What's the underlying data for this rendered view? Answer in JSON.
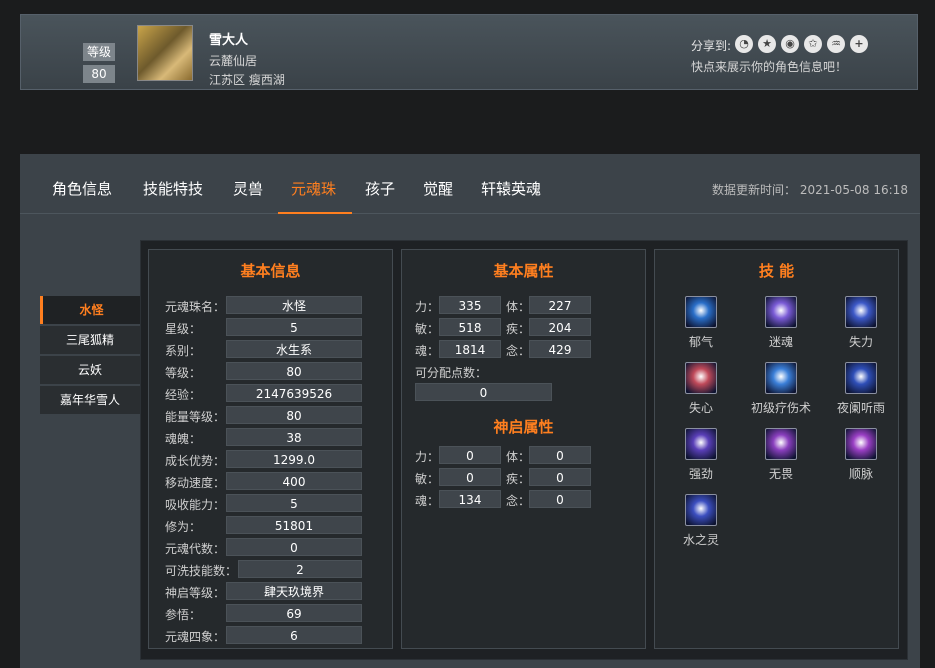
{
  "profile": {
    "level_label": "等级",
    "level_value": "80",
    "name": "雪大人",
    "server": "云麓仙居",
    "region": "江苏区 瘦西湖",
    "share_label": "分享到:",
    "share_icons": [
      "wechat-icon",
      "qzone-icon",
      "weibo-icon",
      "star-icon",
      "tencent-weibo-icon",
      "plus-icon"
    ],
    "share_hint": "快点来展示你的角色信息吧！"
  },
  "tabs": [
    "角色信息",
    "技能特技",
    "灵兽",
    "元魂珠",
    "孩子",
    "觉醒",
    "轩辕英魂"
  ],
  "active_tab": "元魂珠",
  "update_time": "数据更新时间： 2021-05-08 16:18",
  "side_list": [
    "水怪",
    "三尾狐精",
    "云妖",
    "嘉年华雪人"
  ],
  "basic_info": {
    "title": "基本信息",
    "rows": [
      {
        "label": "元魂珠名：",
        "value": "水怪"
      },
      {
        "label": "星级：",
        "value": "5"
      },
      {
        "label": "系别：",
        "value": "水生系"
      },
      {
        "label": "等级：",
        "value": "80"
      },
      {
        "label": "经验：",
        "value": "2147639526"
      },
      {
        "label": "能量等级：",
        "value": "80"
      },
      {
        "label": "魂魄：",
        "value": "38"
      },
      {
        "label": "成长优势：",
        "value": "1299.0"
      },
      {
        "label": "移动速度：",
        "value": "400"
      },
      {
        "label": "吸收能力：",
        "value": "5"
      },
      {
        "label": "修为：",
        "value": "51801"
      },
      {
        "label": "元魂代数：",
        "value": "0"
      },
      {
        "label": "可洗技能数：",
        "value": "2"
      },
      {
        "label": "神启等级：",
        "value": "肆天玖境界"
      },
      {
        "label": "参悟：",
        "value": "69"
      },
      {
        "label": "元魂四象：",
        "value": "6"
      }
    ]
  },
  "basic_attr": {
    "title": "基本属性",
    "pairs": [
      {
        "l1": "力：",
        "v1": "335",
        "l2": "体：",
        "v2": "227"
      },
      {
        "l1": "敏：",
        "v1": "518",
        "l2": "疾：",
        "v2": "204"
      },
      {
        "l1": "魂：",
        "v1": "1814",
        "l2": "念：",
        "v2": "429"
      }
    ],
    "free_points_label": "可分配点数：",
    "free_points": "0"
  },
  "divine_attr": {
    "title": "神启属性",
    "pairs": [
      {
        "l1": "力：",
        "v1": "0",
        "l2": "体：",
        "v2": "0"
      },
      {
        "l1": "敏：",
        "v1": "0",
        "l2": "疾：",
        "v2": "0"
      },
      {
        "l1": "魂：",
        "v1": "134",
        "l2": "念：",
        "v2": "0"
      }
    ]
  },
  "skills": {
    "title": "技 能",
    "items": [
      {
        "name": "郁气",
        "color": "#2a6fc9"
      },
      {
        "name": "迷魂",
        "color": "#7a5bd6"
      },
      {
        "name": "失力",
        "color": "#3d59c8"
      },
      {
        "name": "失心",
        "color": "#c04a5a"
      },
      {
        "name": "初级疗伤术",
        "color": "#3b7fd8"
      },
      {
        "name": "夜阑听雨",
        "color": "#2f4fb8"
      },
      {
        "name": "强劲",
        "color": "#5a3fb8"
      },
      {
        "name": "无畏",
        "color": "#8a3fbe"
      },
      {
        "name": "顺脉",
        "color": "#9a3fc4"
      },
      {
        "name": "水之灵",
        "color": "#3c4fc0"
      }
    ]
  }
}
